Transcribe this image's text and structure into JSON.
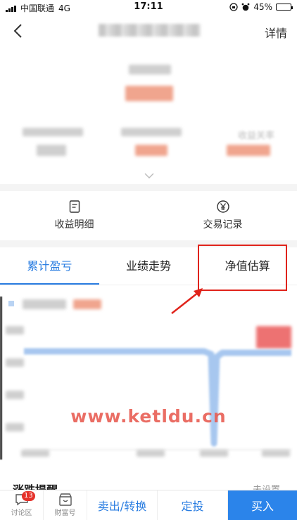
{
  "status_bar": {
    "carrier": "中国联通",
    "network": "4G",
    "time": "17:11",
    "battery": "45%",
    "battery_level": 0.45
  },
  "nav": {
    "detail_label": "详情"
  },
  "summary": {
    "ghost_label": "收益关率"
  },
  "shortcuts": [
    {
      "label": "收益明细",
      "icon": "document-icon"
    },
    {
      "label": "交易记录",
      "icon": "yen-icon"
    }
  ],
  "tabs": [
    {
      "label": "累计盈亏",
      "active": true
    },
    {
      "label": "业绩走势",
      "active": false
    },
    {
      "label": "净值估算",
      "active": false
    }
  ],
  "watermark": "www.ketldu.cn",
  "reminder": {
    "title": "涨跌提醒",
    "status": "未设置"
  },
  "bottom_bar": {
    "discuss": {
      "label": "讨论区",
      "badge": "13"
    },
    "wealth": {
      "label": "财富号"
    },
    "sell_label": "卖出/转换",
    "fixed_label": "定投",
    "buy_label": "买入"
  },
  "colors": {
    "accent": "#2a7de1",
    "highlight": "#e0231b",
    "buy": "#2b84ea",
    "watermark": "#e85a4f"
  }
}
